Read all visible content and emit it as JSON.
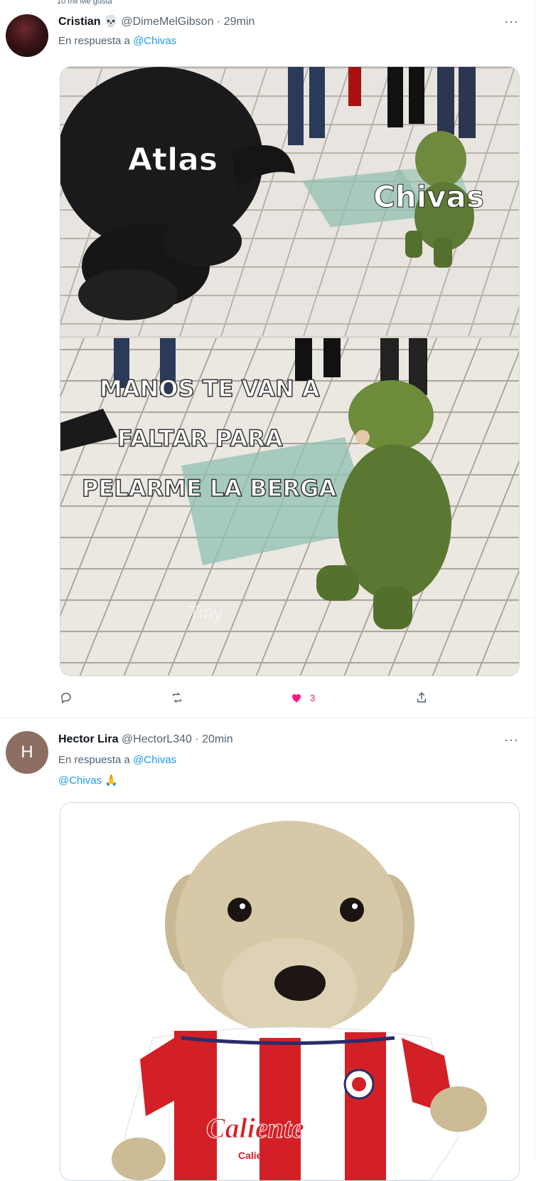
{
  "top_strip": {
    "text": "10 mil Me gusta"
  },
  "tweets": [
    {
      "name": "Cristian",
      "name_emoji": "💀",
      "handle": "@DimeMelGibson",
      "time": "29min",
      "reply_prefix": "En respuesta a",
      "reply_to": "@Chivas",
      "more": "···",
      "media": {
        "caption_atlas": "Atlas",
        "caption_chivas": "Chivas",
        "caption_lines": [
          "MANOS TE VAN A",
          "FALTAR PARA",
          "PELARME LA BERGA"
        ],
        "watermark": "Tiny"
      },
      "actions": {
        "like_count": "3"
      },
      "colors": {
        "like": "#f91880"
      }
    },
    {
      "avatar_letter": "H",
      "name": "Hector Lira",
      "handle": "@HectorL340",
      "time": "20min",
      "reply_prefix": "En respuesta a",
      "reply_to": "@Chivas",
      "body_mention": "@Chivas",
      "body_emoji": "🙏",
      "more": "···",
      "media": {
        "jersey_text": "Caliente",
        "jersey_subtext": "Caliente.mx"
      }
    }
  ],
  "colors": {
    "link": "#1d9bf0",
    "secondary": "#536471",
    "avatar_h": "#8c6e62"
  }
}
